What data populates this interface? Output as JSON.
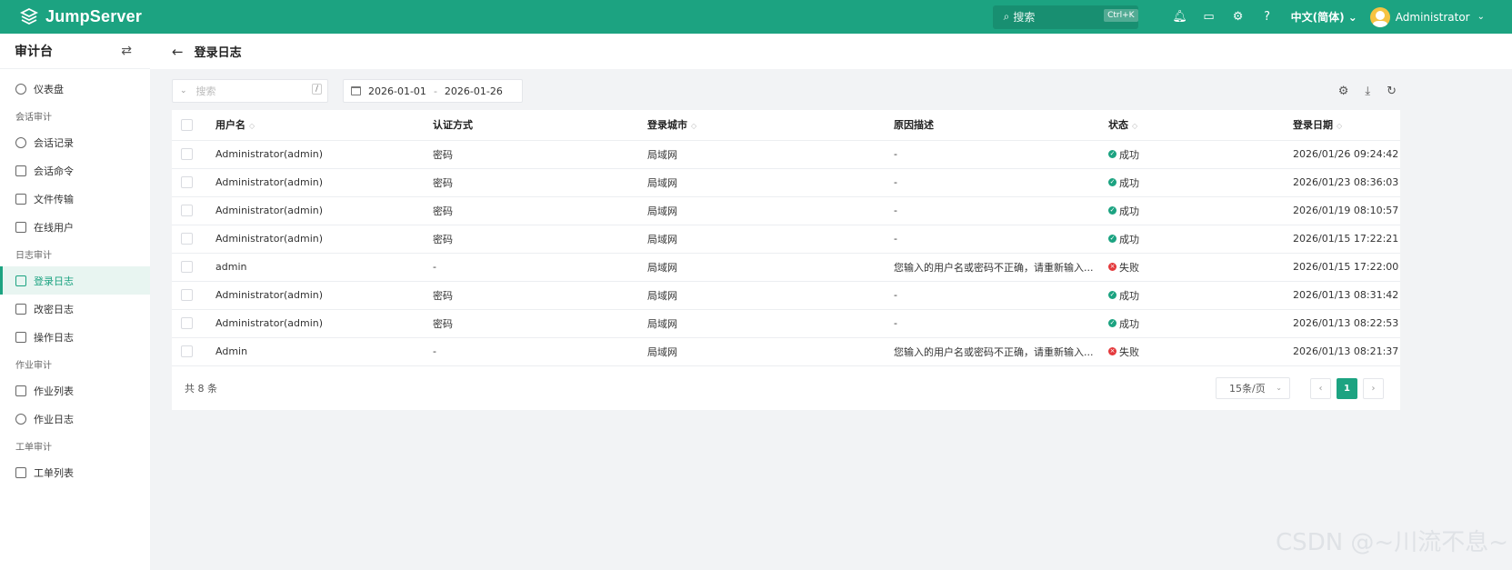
{
  "app": {
    "brand": "JumpServer",
    "search_placeholder": "搜索",
    "search_shortcut": "Ctrl+K",
    "language": "中文(简体)",
    "user": "Administrator"
  },
  "sidebar": {
    "title": "审计台",
    "groups": [
      {
        "items": [
          {
            "label": "仪表盘",
            "icon": "dashboard-icon"
          }
        ]
      },
      {
        "label": "会话审计",
        "items": [
          {
            "label": "会话记录",
            "icon": "link-icon"
          },
          {
            "label": "会话命令",
            "icon": "terminal-icon"
          },
          {
            "label": "文件传输",
            "icon": "file-icon"
          },
          {
            "label": "在线用户",
            "icon": "monitor-icon"
          }
        ]
      },
      {
        "label": "日志审计",
        "items": [
          {
            "label": "登录日志",
            "icon": "login-icon",
            "active": true
          },
          {
            "label": "改密日志",
            "icon": "lock-icon"
          },
          {
            "label": "操作日志",
            "icon": "list-icon"
          }
        ]
      },
      {
        "label": "作业审计",
        "items": [
          {
            "label": "作业列表",
            "icon": "checklist-icon"
          },
          {
            "label": "作业日志",
            "icon": "history-icon"
          }
        ]
      },
      {
        "label": "工单审计",
        "items": [
          {
            "label": "工单列表",
            "icon": "ticket-icon"
          }
        ]
      }
    ]
  },
  "page": {
    "title": "登录日志"
  },
  "toolbar": {
    "search_placeholder": "搜索",
    "search_key": "/",
    "date_start": "2026-01-01",
    "date_sep": "-",
    "date_end": "2026-01-26"
  },
  "table": {
    "columns": [
      "用户名",
      "认证方式",
      "登录城市",
      "原因描述",
      "状态",
      "登录日期"
    ],
    "rows": [
      {
        "user": "Administrator(admin)",
        "auth": "密码",
        "city": "局域网",
        "reason": "-",
        "status": "成功",
        "ok": true,
        "date": "2026/01/26 09:24:42"
      },
      {
        "user": "Administrator(admin)",
        "auth": "密码",
        "city": "局域网",
        "reason": "-",
        "status": "成功",
        "ok": true,
        "date": "2026/01/23 08:36:03"
      },
      {
        "user": "Administrator(admin)",
        "auth": "密码",
        "city": "局域网",
        "reason": "-",
        "status": "成功",
        "ok": true,
        "date": "2026/01/19 08:10:57"
      },
      {
        "user": "Administrator(admin)",
        "auth": "密码",
        "city": "局域网",
        "reason": "-",
        "status": "成功",
        "ok": true,
        "date": "2026/01/15 17:22:21"
      },
      {
        "user": "admin",
        "auth": "-",
        "city": "局域网",
        "reason": "您输入的用户名或密码不正确，请重新输入...",
        "status": "失败",
        "ok": false,
        "date": "2026/01/15 17:22:00"
      },
      {
        "user": "Administrator(admin)",
        "auth": "密码",
        "city": "局域网",
        "reason": "-",
        "status": "成功",
        "ok": true,
        "date": "2026/01/13 08:31:42"
      },
      {
        "user": "Administrator(admin)",
        "auth": "密码",
        "city": "局域网",
        "reason": "-",
        "status": "成功",
        "ok": true,
        "date": "2026/01/13 08:22:53"
      },
      {
        "user": "Admin",
        "auth": "-",
        "city": "局域网",
        "reason": "您输入的用户名或密码不正确，请重新输入...",
        "status": "失败",
        "ok": false,
        "date": "2026/01/13 08:21:37"
      }
    ]
  },
  "footer": {
    "total": "共 8 条",
    "page_size": "15条/页",
    "current_page": "1"
  },
  "watermark": "CSDN @~川流不息~",
  "colors": {
    "brand": "#1ca381",
    "success": "#1ca381",
    "fail": "#e4393c"
  }
}
